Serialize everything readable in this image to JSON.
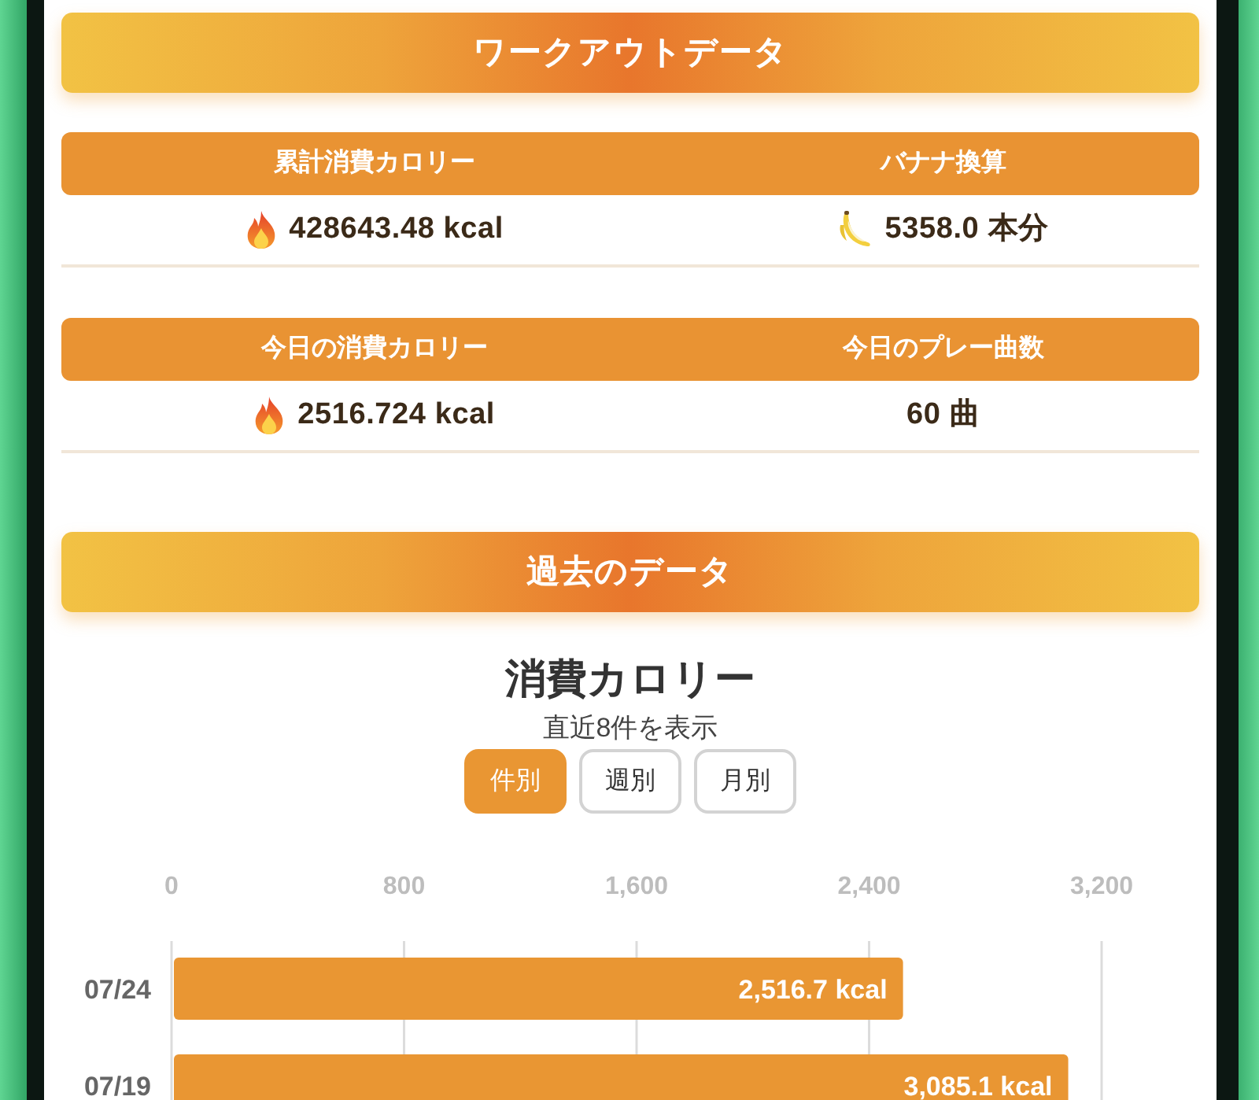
{
  "workout": {
    "title": "ワークアウトデータ",
    "tables": [
      {
        "columns": [
          {
            "kind": "calorie",
            "label": "累計消費カロリー",
            "value": "428643.48 kcal"
          },
          {
            "kind": "banana",
            "label": "バナナ換算",
            "value": "5358.0 本分"
          }
        ]
      },
      {
        "columns": [
          {
            "kind": "calorie",
            "label": "今日の消費カロリー",
            "value": "2516.724 kcal"
          },
          {
            "kind": "plain",
            "label": "今日のプレー曲数",
            "value": "60 曲"
          }
        ]
      }
    ]
  },
  "history": {
    "title": "過去のデータ",
    "chart_title": "消費カロリー",
    "subtitle": "直近8件を表示",
    "period_buttons": [
      {
        "label": "件別",
        "selected": true
      },
      {
        "label": "週別",
        "selected": false
      },
      {
        "label": "月別",
        "selected": false
      }
    ],
    "chart_data": {
      "type": "bar",
      "orientation": "horizontal",
      "grid": true,
      "categories": [
        "07/24",
        "07/19"
      ],
      "values": [
        2516.7,
        3085.1
      ],
      "xlim": [
        0,
        3200
      ],
      "xticks": [
        0,
        800,
        {
          "value": 1600,
          "label": "1,600"
        },
        {
          "value": 2400,
          "label": "2,400"
        },
        {
          "value": 3200,
          "label": "3,200"
        }
      ],
      "value_labels": [
        "2,516.7 kcal",
        "3,085.1 kcal"
      ]
    }
  }
}
